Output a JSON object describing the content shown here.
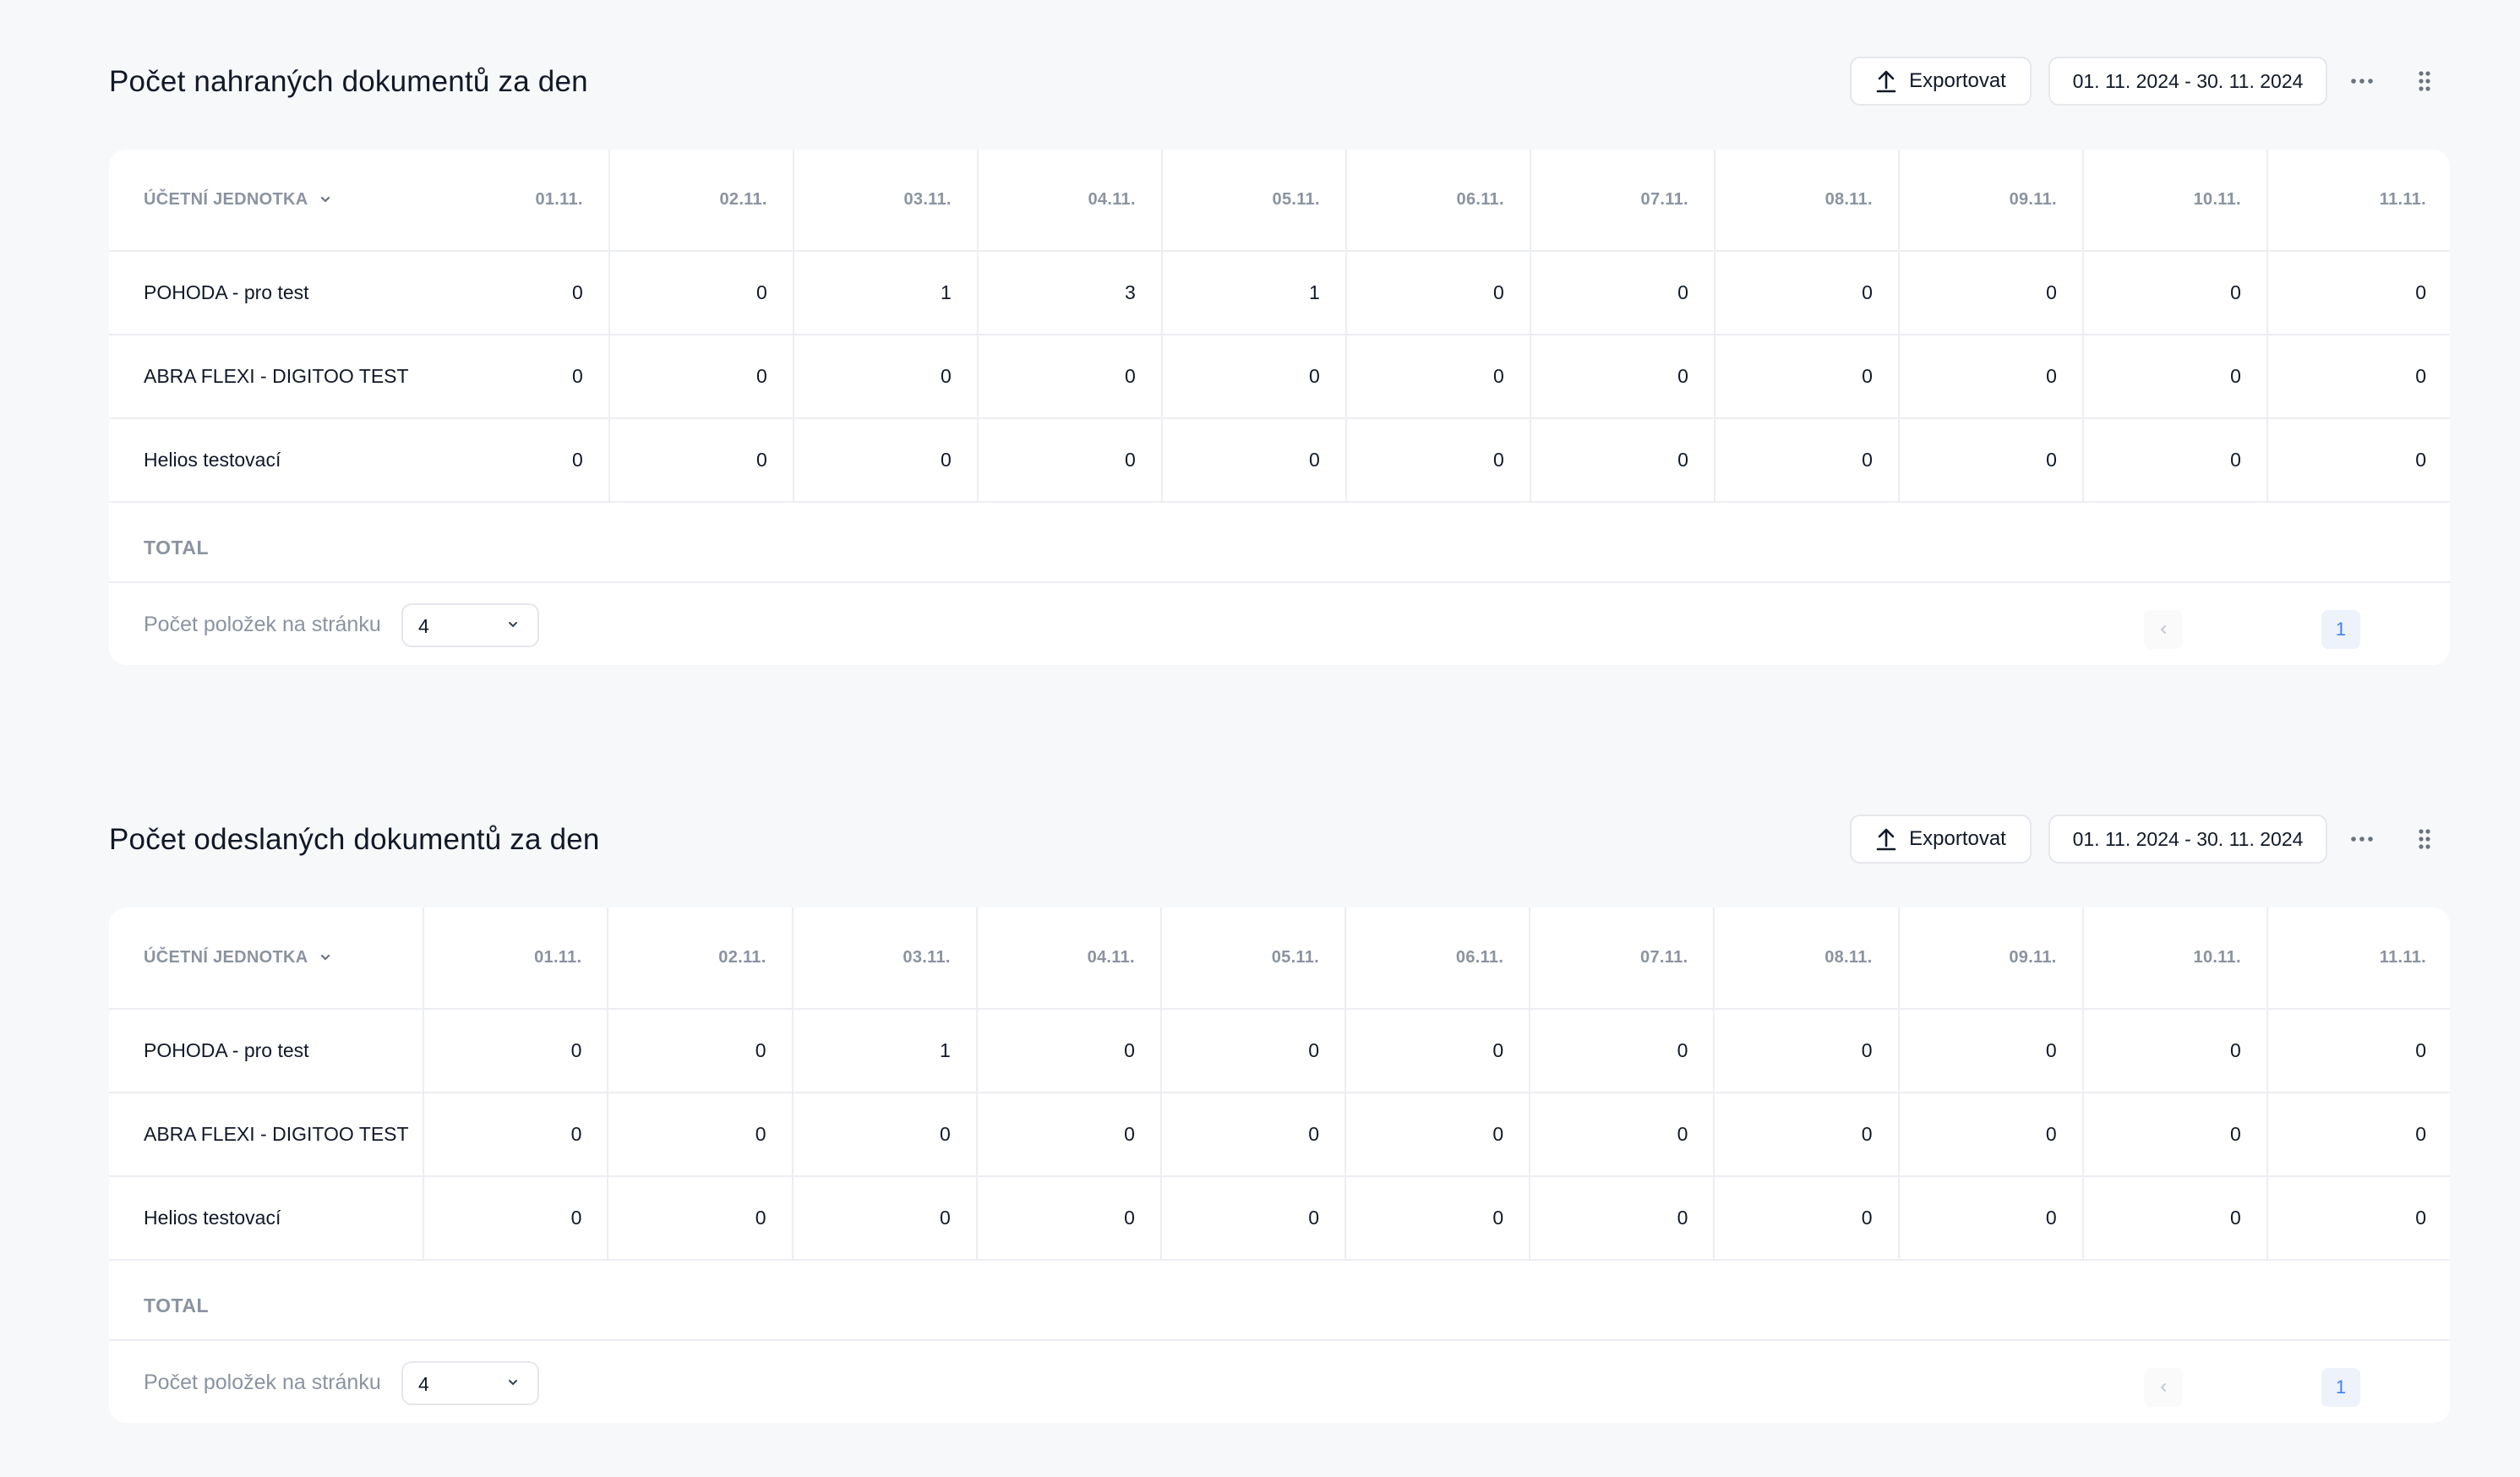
{
  "sections": [
    {
      "title": "Počet nahraných dokumentů za den",
      "export_label": "Exportovat",
      "date_range": "01. 11. 2024 - 30. 11. 2024",
      "unit_header": "ÚČETNÍ JEDNOTKA",
      "days": [
        "01.11.",
        "02.11.",
        "03.11.",
        "04.11.",
        "05.11.",
        "06.11.",
        "07.11.",
        "08.11.",
        "09.11.",
        "10.11.",
        "11.11."
      ],
      "rows": [
        {
          "unit": "POHODA - pro test",
          "values": [
            "0",
            "0",
            "1",
            "3",
            "1",
            "0",
            "0",
            "0",
            "0",
            "0",
            "0"
          ]
        },
        {
          "unit": "ABRA FLEXI - DIGITOO TEST",
          "values": [
            "0",
            "0",
            "0",
            "0",
            "0",
            "0",
            "0",
            "0",
            "0",
            "0",
            "0"
          ]
        },
        {
          "unit": "Helios testovací",
          "values": [
            "0",
            "0",
            "0",
            "0",
            "0",
            "0",
            "0",
            "0",
            "0",
            "0",
            "0"
          ]
        }
      ],
      "total_label": "TOTAL",
      "per_page_label": "Počet položek na stránku",
      "per_page_value": "4",
      "current_page": "1"
    },
    {
      "title": "Počet odeslaných dokumentů za den",
      "export_label": "Exportovat",
      "date_range": "01. 11. 2024 - 30. 11. 2024",
      "unit_header": "ÚČETNÍ JEDNOTKA",
      "days": [
        "01.11.",
        "02.11.",
        "03.11.",
        "04.11.",
        "05.11.",
        "06.11.",
        "07.11.",
        "08.11.",
        "09.11.",
        "10.11.",
        "11.11."
      ],
      "rows": [
        {
          "unit": "POHODA - pro test",
          "values": [
            "0",
            "0",
            "1",
            "0",
            "0",
            "0",
            "0",
            "0",
            "0",
            "0",
            "0"
          ]
        },
        {
          "unit": "ABRA FLEXI - DIGITOO TEST",
          "values": [
            "0",
            "0",
            "0",
            "0",
            "0",
            "0",
            "0",
            "0",
            "0",
            "0",
            "0"
          ]
        },
        {
          "unit": "Helios testovací",
          "values": [
            "0",
            "0",
            "0",
            "0",
            "0",
            "0",
            "0",
            "0",
            "0",
            "0",
            "0"
          ]
        }
      ],
      "total_label": "TOTAL",
      "per_page_label": "Počet položek na stránku",
      "per_page_value": "4",
      "current_page": "1"
    }
  ],
  "colors": {
    "background": "#f7f8fa",
    "card": "#ffffff",
    "border": "#eceef2",
    "muted_text": "#8b93a1",
    "accent": "#3b82f6"
  }
}
